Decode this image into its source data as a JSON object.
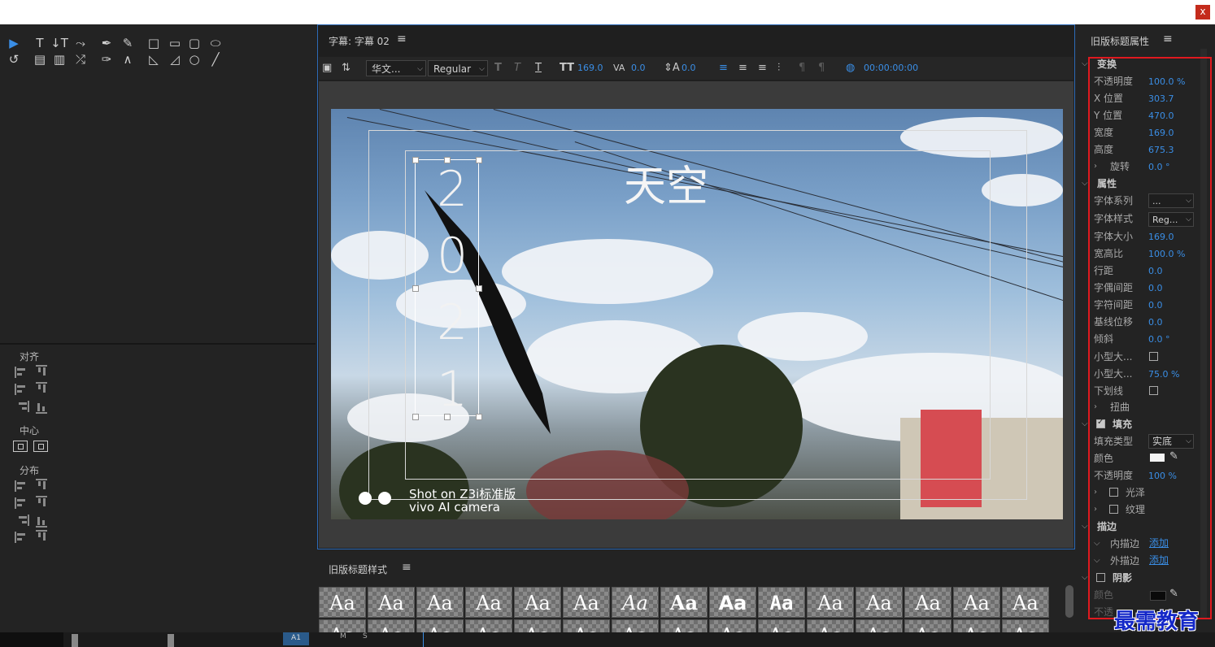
{
  "window": {
    "close_label": "x"
  },
  "left": {
    "align_label": "对齐",
    "center_label": "中心",
    "distribute_label": "分布"
  },
  "title_panel": {
    "title": "字幕: 字幕 02",
    "menu_icon": "≡",
    "font_family": "华文...",
    "font_style": "Regular",
    "font_size": "169.0",
    "kerning": "0.0",
    "leading": "0.0",
    "timecode": "00:00:00:00",
    "vertical_text": [
      "2",
      "0",
      "2",
      "1"
    ],
    "sky_text": "天空",
    "watermark_line1": "Shot on Z3i标准版",
    "watermark_line2": "vivo AI camera"
  },
  "styles_panel": {
    "title": "旧版标题样式",
    "menu_icon": "≡",
    "swatch_label": "Aa"
  },
  "timeline": {
    "track_label": "A1",
    "m_label": "M",
    "s_label": "S"
  },
  "properties": {
    "title": "旧版标题属性",
    "menu_icon": "≡",
    "transform": {
      "header": "变换",
      "opacity_label": "不透明度",
      "opacity": "100.0 %",
      "x_label": "X 位置",
      "x": "303.7",
      "y_label": "Y 位置",
      "y": "470.0",
      "width_label": "宽度",
      "width": "169.0",
      "height_label": "高度",
      "height": "675.3",
      "rotation_label": "旋转",
      "rotation": "0.0 °"
    },
    "attributes": {
      "header": "属性",
      "font_family_label": "字体系列",
      "font_family": "...",
      "font_style_label": "字体样式",
      "font_style": "Reg...",
      "font_size_label": "字体大小",
      "font_size": "169.0",
      "aspect_label": "宽高比",
      "aspect": "100.0 %",
      "leading_label": "行距",
      "leading": "0.0",
      "kerning_label": "字偶间距",
      "kerning": "0.0",
      "tracking_label": "字符间距",
      "tracking": "0.0",
      "baseline_label": "基线位移",
      "baseline": "0.0",
      "slant_label": "倾斜",
      "slant": "0.0 °",
      "smallcaps_label": "小型大...",
      "smallcaps_size_label": "小型大...",
      "smallcaps_size": "75.0 %",
      "underline_label": "下划线",
      "distort_label": "扭曲"
    },
    "fill": {
      "header": "填充",
      "type_label": "填充类型",
      "type": "实底",
      "color_label": "颜色",
      "opacity_label": "不透明度",
      "opacity": "100 %",
      "sheen_label": "光泽",
      "texture_label": "纹理"
    },
    "strokes": {
      "header": "描边",
      "inner_label": "内描边",
      "inner_add": "添加",
      "outer_label": "外描边",
      "outer_add": "添加"
    },
    "shadow": {
      "header": "阴影",
      "color_label": "颜色",
      "opacity_label": "不透"
    }
  },
  "brand_watermark": "最需教育",
  "colors": {
    "accent": "#3a8ee6",
    "highlight_box": "#e0191f",
    "brand": "#1428c8"
  }
}
